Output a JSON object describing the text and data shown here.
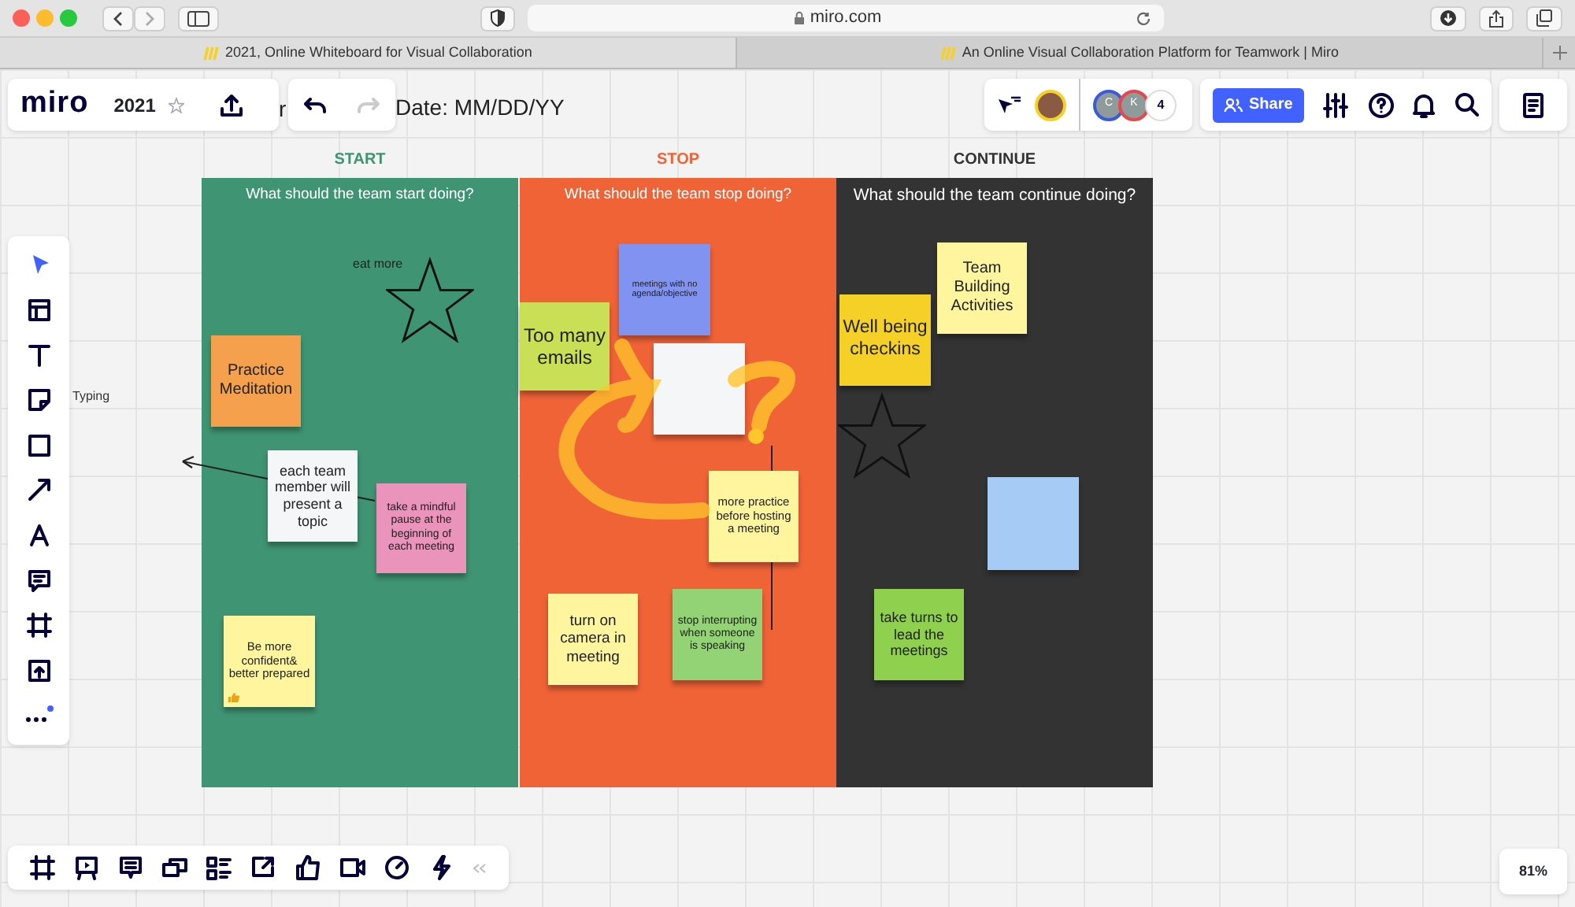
{
  "browser": {
    "url": "miro.com",
    "tabs": [
      {
        "title": "2021, Online Whiteboard for Visual Collaboration",
        "selected": true
      },
      {
        "title": "An Online Visual Collaboration Platform for Teamwork | Miro",
        "selected": false
      }
    ]
  },
  "header": {
    "logo": "miro",
    "board_name": "2021",
    "title_fragment": "r",
    "date_text": "Date: MM/DD/YY",
    "collaborators": [
      {
        "initial": "C",
        "color": "#3b5bdb"
      },
      {
        "initial": "K",
        "color": "#e5484d"
      }
    ],
    "more_count": "4",
    "share_label": "Share"
  },
  "board": {
    "columns": [
      {
        "heading": "START",
        "prompt": "What should the team start doing?",
        "color": "#3f9473"
      },
      {
        "heading": "STOP",
        "prompt": "What should the team stop doing?",
        "color": "#f06337"
      },
      {
        "heading": "CONTINUE",
        "prompt": "What should the team continue doing?",
        "color": "#333333"
      }
    ],
    "notes": [
      {
        "text": "Practice Meditation",
        "color": "#f4a04c"
      },
      {
        "text": "each team member will present a topic",
        "color": "#f5f6f8"
      },
      {
        "text": "take a mindful pause at the beginning of each meeting",
        "color": "#ea94bb"
      },
      {
        "text": "Be more confident& better prepared",
        "color": "#fef59e"
      },
      {
        "text": "meetings with no agenda/objective",
        "color": "#8093f1"
      },
      {
        "text": "Too many emails",
        "color": "#c9df56"
      },
      {
        "color": "#f5f6f8"
      },
      {
        "text": "more practice before hosting a meeting",
        "color": "#fef59e"
      },
      {
        "text": "turn on camera in meeting",
        "color": "#fef59e"
      },
      {
        "text": "stop interrupting when someone is speaking",
        "color": "#93d275"
      },
      {
        "text": "Team Building Activities",
        "color": "#fef59e"
      },
      {
        "text": "Well being checkins",
        "color": "#f5d128"
      },
      {
        "color": "#a6ccf5"
      },
      {
        "text": "take turns to lead the meetings",
        "color": "#8fd14f"
      }
    ],
    "free_text": "eat more"
  },
  "cursor_label": "Typing",
  "zoom": "81%"
}
